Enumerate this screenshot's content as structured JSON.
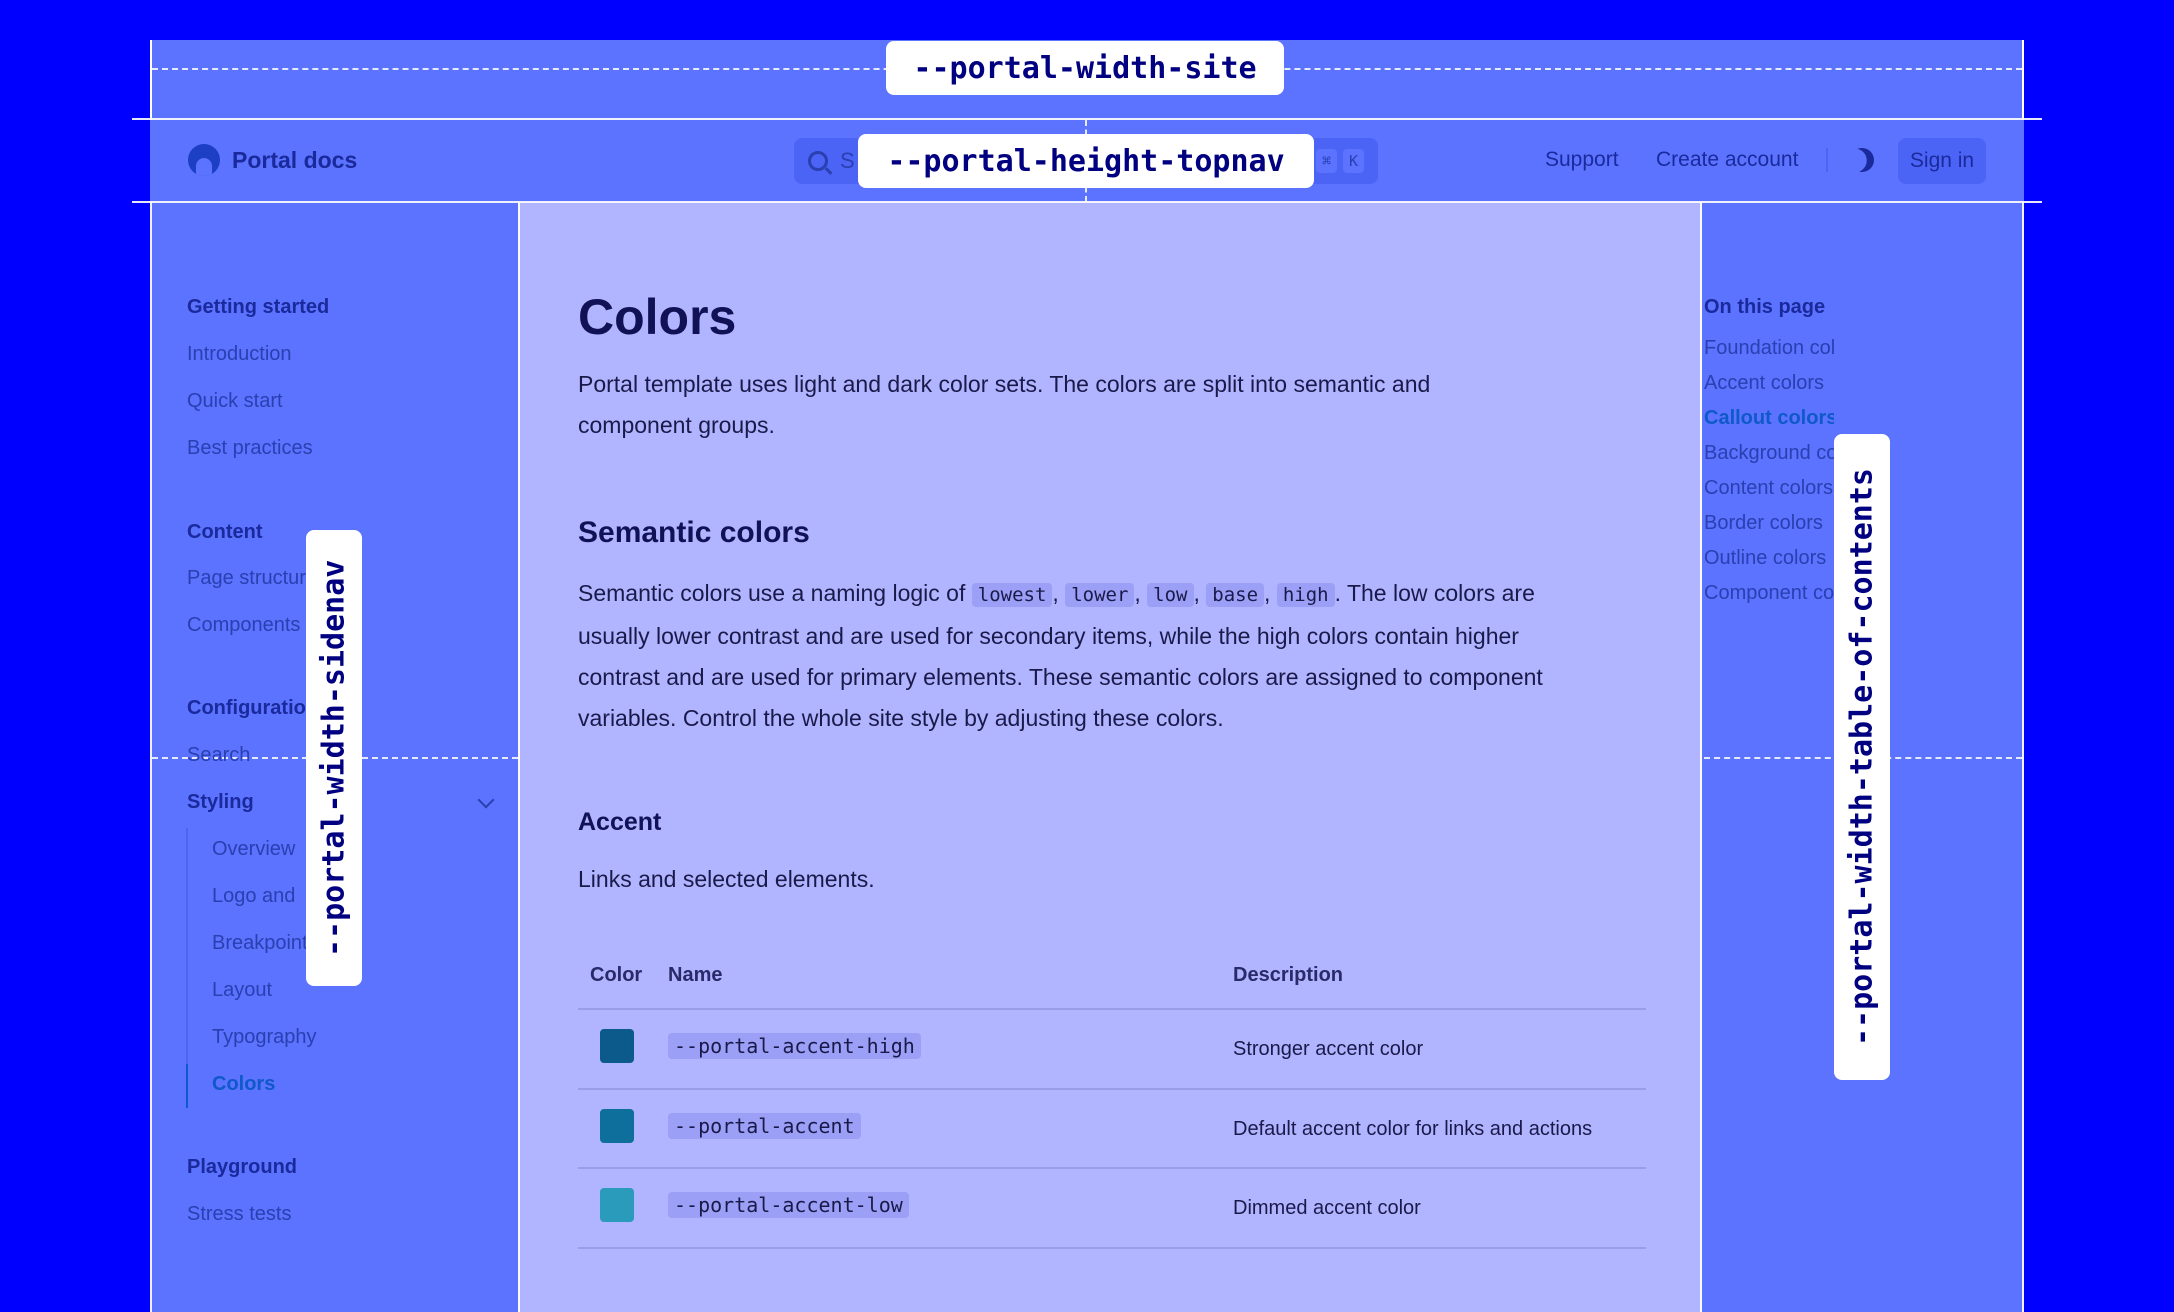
{
  "labels": {
    "site_width": "--portal-width-site",
    "topnav_height": "--portal-height-topnav",
    "sidenav_width": "--portal-width-sidenav",
    "toc_width": "--portal-width-table-of-contents"
  },
  "topnav": {
    "brand": "Portal docs",
    "search_placeholder": "S",
    "kbd_cmd": "⌘",
    "kbd_key": "K",
    "support": "Support",
    "create_account": "Create account",
    "sign_in": "Sign in"
  },
  "sidebar": {
    "group1": {
      "title": "Getting started",
      "items": [
        "Introduction",
        "Quick start",
        "Best practices"
      ]
    },
    "group2": {
      "title": "Content",
      "items": [
        "Page structure",
        "Components"
      ]
    },
    "group3": {
      "title": "Configuration",
      "items": [
        "Search"
      ]
    },
    "styling": {
      "title": "Styling",
      "items": [
        "Overview",
        "Logo and",
        "Breakpoints",
        "Layout",
        "Typography",
        "Colors"
      ]
    },
    "group4": {
      "title": "Playground",
      "items": [
        "Stress tests"
      ]
    }
  },
  "main": {
    "title": "Colors",
    "intro_line1": "Portal template uses light and dark color sets. The colors are split into semantic and",
    "intro_line2": "component groups.",
    "semantic_heading": "Semantic colors",
    "semantic_prefix": "Semantic colors use a naming logic of",
    "codes": [
      "lowest",
      "lower",
      "low",
      "base",
      "high"
    ],
    "semantic_suffix": ". The low colors are",
    "semantic_line2": "usually lower contrast and are used for secondary items, while the high colors contain higher",
    "semantic_line3": "contrast and are used for primary elements. These semantic colors are assigned to component",
    "semantic_line4": "variables. Control the whole site style by adjusting these colors.",
    "accent_heading": "Accent",
    "accent_desc": "Links and selected elements.",
    "table": {
      "headers": [
        "Color",
        "Name",
        "Description"
      ],
      "rows": [
        {
          "color": "#0c5a8c",
          "name": "--portal-accent-high",
          "description": "Stronger accent color"
        },
        {
          "color": "#0e6f9c",
          "name": "--portal-accent",
          "description": "Default accent color for links and actions"
        },
        {
          "color": "#2a9bbb",
          "name": "--portal-accent-low",
          "description": "Dimmed accent color"
        }
      ]
    }
  },
  "toc": {
    "title": "On this page",
    "items": [
      "Foundation colors",
      "Accent colors",
      "Callout colors",
      "Background colors",
      "Content colors",
      "Border colors",
      "Outline colors",
      "Component colors"
    ],
    "active_index": 2
  }
}
